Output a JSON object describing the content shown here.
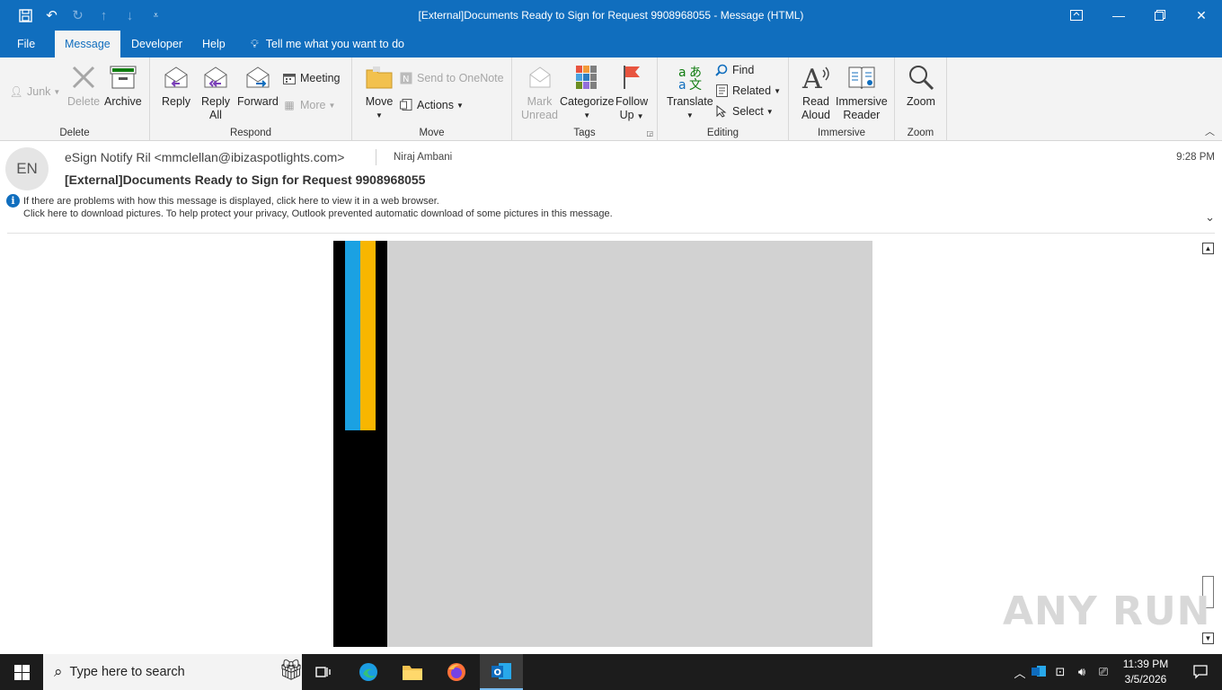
{
  "window": {
    "title": "[External]Documents Ready to Sign for Request 9908968055  -  Message (HTML)"
  },
  "qat": {
    "save_icon": "save-icon",
    "undo_icon": "undo-icon",
    "redo_icon": "redo-icon",
    "up_icon": "arrow-up-icon",
    "down_icon": "arrow-down-icon",
    "customize_icon": "customize-icon"
  },
  "tabs": [
    "File",
    "Message",
    "Developer",
    "Help"
  ],
  "tell_me": "Tell me what you want to do",
  "ribbon": {
    "delete_group": {
      "label": "Delete",
      "junk": "Junk",
      "delete": "Delete",
      "archive": "Archive"
    },
    "respond_group": {
      "label": "Respond",
      "reply": "Reply",
      "reply_all_1": "Reply",
      "reply_all_2": "All",
      "forward": "Forward",
      "meeting": "Meeting",
      "more": "More"
    },
    "move_group": {
      "label": "Move",
      "move": "Move",
      "onenote": "Send to OneNote",
      "actions": "Actions"
    },
    "tags_group": {
      "label": "Tags",
      "mark_1": "Mark",
      "mark_2": "Unread",
      "categorize": "Categorize",
      "follow_1": "Follow",
      "follow_2": "Up"
    },
    "editing_group": {
      "label": "Editing",
      "translate": "Translate",
      "find": "Find",
      "related": "Related",
      "select": "Select"
    },
    "immersive_group": {
      "label": "Immersive",
      "read_1": "Read",
      "read_2": "Aloud",
      "imm_1": "Immersive",
      "imm_2": "Reader"
    },
    "zoom_group": {
      "label": "Zoom",
      "zoom": "Zoom"
    }
  },
  "message": {
    "avatar_initials": "EN",
    "from": "eSign Notify Ril <mmclellan@ibizaspotlights.com>",
    "to": "Niraj Ambani",
    "time": "9:28 PM",
    "subject": "[External]Documents Ready to Sign for Request 9908968055",
    "info_line_1": "If there are problems with how this message is displayed, click here to view it in a web browser.",
    "info_line_2": "Click here to download pictures. To help protect your privacy, Outlook prevented automatic download of some pictures in this message."
  },
  "watermark": "ANY RUN",
  "taskbar": {
    "search_placeholder": "Type here to search",
    "clock_time": "11:39 PM",
    "clock_date": "3/5/2026"
  },
  "colors": {
    "accent": "#106ebe",
    "stripe_blue": "#1ba1e2",
    "stripe_orange": "#f8b600"
  }
}
